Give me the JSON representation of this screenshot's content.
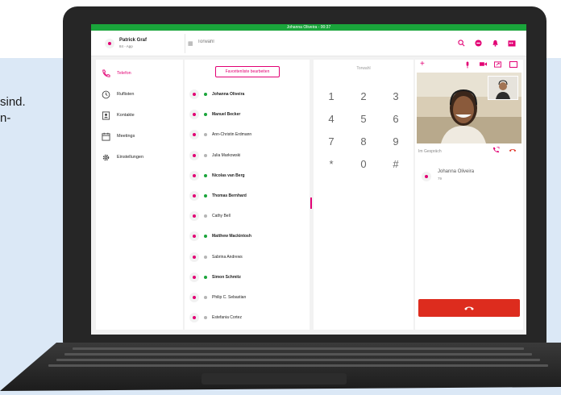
{
  "background_text": {
    "line1": "sind.",
    "line2": "n-"
  },
  "app": {
    "call_status_bar": "Johanna Oliveira - 00:37"
  },
  "header": {
    "user_name": "Patrick Graf",
    "user_sub": "84 - App",
    "dial_placeholder": "Torwahl",
    "icons": [
      "search-icon",
      "status-icon",
      "bell-icon",
      "calendar-icon"
    ]
  },
  "sidebar": {
    "items": [
      {
        "label": "Telefon",
        "icon": "phone-icon",
        "active": true
      },
      {
        "label": "Ruflisten",
        "icon": "history-icon",
        "active": false
      },
      {
        "label": "Kontakte",
        "icon": "contacts-icon",
        "active": false
      },
      {
        "label": "Meetings",
        "icon": "calendar-icon",
        "active": false
      },
      {
        "label": "Einstellungen",
        "icon": "gear-icon",
        "active": false
      }
    ]
  },
  "contacts": {
    "edit_favorites_label": "Favoritenliste bearbeiten",
    "items": [
      {
        "name": "Johanna Oliveira",
        "status": "online"
      },
      {
        "name": "Manuel Becker",
        "status": "online"
      },
      {
        "name": "Ann-Christin Erdmann",
        "status": "offline"
      },
      {
        "name": "Julia Markowski",
        "status": "offline"
      },
      {
        "name": "Nicolas van Berg",
        "status": "online"
      },
      {
        "name": "Thomas Bernhard",
        "status": "online"
      },
      {
        "name": "Cathy Bell",
        "status": "offline"
      },
      {
        "name": "Matthew Mackintosh",
        "status": "online"
      },
      {
        "name": "Sabrina Andrews",
        "status": "offline"
      },
      {
        "name": "Simon Schmitz",
        "status": "online"
      },
      {
        "name": "Philip C. Sebastian",
        "status": "offline"
      },
      {
        "name": "Estefania Cortez",
        "status": "offline"
      }
    ]
  },
  "dialpad": {
    "label": "Torwahl",
    "keys": [
      "1",
      "2",
      "3",
      "4",
      "5",
      "6",
      "7",
      "8",
      "9",
      "*",
      "0",
      "#"
    ]
  },
  "call": {
    "toolbar_icons": [
      "add-icon",
      "microphone-icon",
      "camera-icon",
      "screen-share-icon",
      "window-icon"
    ],
    "status_label": "Im Gespräch",
    "peer_name": "Johanna Oliveira",
    "peer_number": "79",
    "hangup_icon": "hangup-icon"
  },
  "colors": {
    "brand": "#e20074",
    "online": "#1aa53b",
    "offline": "#b5b5b5",
    "hangup": "#dd2c1e",
    "status_bar": "#1aa53b"
  }
}
